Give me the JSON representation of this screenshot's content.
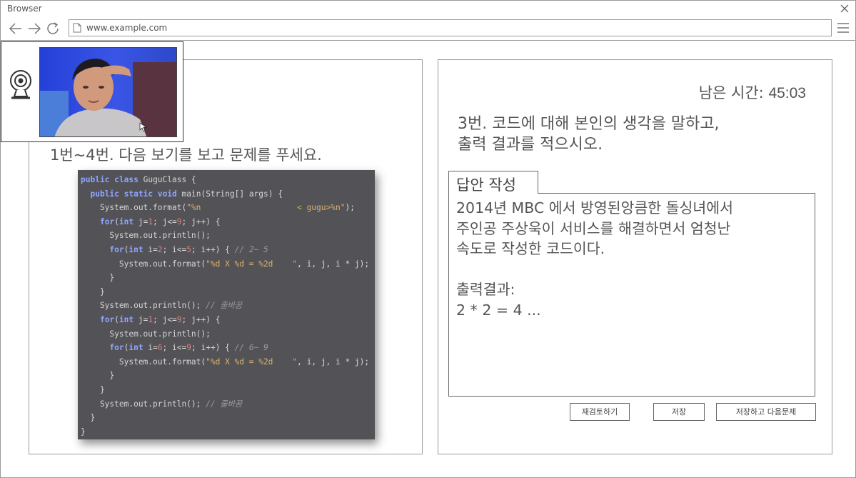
{
  "browser": {
    "title": "Browser",
    "url": "www.example.com"
  },
  "left": {
    "question": "1번~4번. 다음 보기를 보고 문제를 푸세요."
  },
  "code_lines": [
    "public class GuguClass {",
    "  public static void main(String[] args) {",
    "    System.out.format(\"%n                    < gugu>%n\");",
    "    for(int j=1; j<=9; j++) {",
    "      System.out.println();",
    "      for(int i=2; i<=5; i++) { // 2~ 5",
    "        System.out.format(\"%d X %d = %2d    \", i, j, i * j);",
    "      }",
    "    }",
    "    System.out.println(); // 줄바꿈",
    "    for(int j=1; j<=9; j++) {",
    "      System.out.println();",
    "      for(int i=6; i<=9; i++) { // 6~ 9",
    "        System.out.format(\"%d X %d = %2d    \", i, j, i * j);",
    "      }",
    "    }",
    "    System.out.println(); // 줄바꿈",
    "  }",
    "}"
  ],
  "right": {
    "timer_label": "남은 시간:",
    "timer_value": "45:03",
    "question_line1": "3번. 코드에 대해 본인의 생각을 말하고,",
    "question_line2": "출력 결과를 적으시오.",
    "answer_tab": "답안 작성",
    "answer_text": "2014년 MBC 에서 방영된앙큼한 돌싱녀에서\n주인공 주상욱이 서비스를 해결하면서 엄청난\n속도로 작성한 코드이다.\n\n출력결과:\n2 * 2 = 4 ...",
    "buttons": {
      "review": "재검토하기",
      "save": "저장",
      "save_next": "저장하고 다음문제"
    }
  },
  "icons": {
    "back": "arrow-left-icon",
    "forward": "arrow-right-icon",
    "reload": "reload-icon",
    "page": "page-icon",
    "menu": "hamburger-menu-icon",
    "close": "close-icon",
    "webcam": "webcam-icon"
  },
  "colors": {
    "code_background": "#535357",
    "code_keyword": "#8fa5ff",
    "code_string": "#d9b26a",
    "code_number": "#e87c7c",
    "border": "#9a9a9a"
  }
}
